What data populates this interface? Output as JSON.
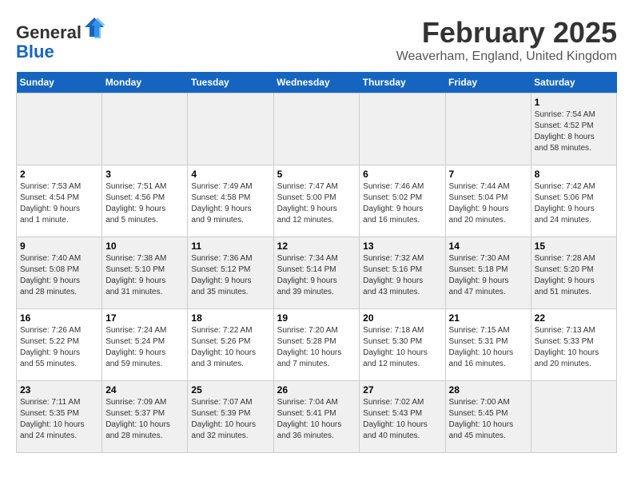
{
  "header": {
    "logo_general": "General",
    "logo_blue": "Blue",
    "month_title": "February 2025",
    "location": "Weaverham, England, United Kingdom"
  },
  "weekdays": [
    "Sunday",
    "Monday",
    "Tuesday",
    "Wednesday",
    "Thursday",
    "Friday",
    "Saturday"
  ],
  "weeks": [
    [
      {
        "day": "",
        "info": ""
      },
      {
        "day": "",
        "info": ""
      },
      {
        "day": "",
        "info": ""
      },
      {
        "day": "",
        "info": ""
      },
      {
        "day": "",
        "info": ""
      },
      {
        "day": "",
        "info": ""
      },
      {
        "day": "1",
        "info": "Sunrise: 7:54 AM\nSunset: 4:52 PM\nDaylight: 8 hours\nand 58 minutes."
      }
    ],
    [
      {
        "day": "2",
        "info": "Sunrise: 7:53 AM\nSunset: 4:54 PM\nDaylight: 9 hours\nand 1 minute."
      },
      {
        "day": "3",
        "info": "Sunrise: 7:51 AM\nSunset: 4:56 PM\nDaylight: 9 hours\nand 5 minutes."
      },
      {
        "day": "4",
        "info": "Sunrise: 7:49 AM\nSunset: 4:58 PM\nDaylight: 9 hours\nand 9 minutes."
      },
      {
        "day": "5",
        "info": "Sunrise: 7:47 AM\nSunset: 5:00 PM\nDaylight: 9 hours\nand 12 minutes."
      },
      {
        "day": "6",
        "info": "Sunrise: 7:46 AM\nSunset: 5:02 PM\nDaylight: 9 hours\nand 16 minutes."
      },
      {
        "day": "7",
        "info": "Sunrise: 7:44 AM\nSunset: 5:04 PM\nDaylight: 9 hours\nand 20 minutes."
      },
      {
        "day": "8",
        "info": "Sunrise: 7:42 AM\nSunset: 5:06 PM\nDaylight: 9 hours\nand 24 minutes."
      }
    ],
    [
      {
        "day": "9",
        "info": "Sunrise: 7:40 AM\nSunset: 5:08 PM\nDaylight: 9 hours\nand 28 minutes."
      },
      {
        "day": "10",
        "info": "Sunrise: 7:38 AM\nSunset: 5:10 PM\nDaylight: 9 hours\nand 31 minutes."
      },
      {
        "day": "11",
        "info": "Sunrise: 7:36 AM\nSunset: 5:12 PM\nDaylight: 9 hours\nand 35 minutes."
      },
      {
        "day": "12",
        "info": "Sunrise: 7:34 AM\nSunset: 5:14 PM\nDaylight: 9 hours\nand 39 minutes."
      },
      {
        "day": "13",
        "info": "Sunrise: 7:32 AM\nSunset: 5:16 PM\nDaylight: 9 hours\nand 43 minutes."
      },
      {
        "day": "14",
        "info": "Sunrise: 7:30 AM\nSunset: 5:18 PM\nDaylight: 9 hours\nand 47 minutes."
      },
      {
        "day": "15",
        "info": "Sunrise: 7:28 AM\nSunset: 5:20 PM\nDaylight: 9 hours\nand 51 minutes."
      }
    ],
    [
      {
        "day": "16",
        "info": "Sunrise: 7:26 AM\nSunset: 5:22 PM\nDaylight: 9 hours\nand 55 minutes."
      },
      {
        "day": "17",
        "info": "Sunrise: 7:24 AM\nSunset: 5:24 PM\nDaylight: 9 hours\nand 59 minutes."
      },
      {
        "day": "18",
        "info": "Sunrise: 7:22 AM\nSunset: 5:26 PM\nDaylight: 10 hours\nand 3 minutes."
      },
      {
        "day": "19",
        "info": "Sunrise: 7:20 AM\nSunset: 5:28 PM\nDaylight: 10 hours\nand 7 minutes."
      },
      {
        "day": "20",
        "info": "Sunrise: 7:18 AM\nSunset: 5:30 PM\nDaylight: 10 hours\nand 12 minutes."
      },
      {
        "day": "21",
        "info": "Sunrise: 7:15 AM\nSunset: 5:31 PM\nDaylight: 10 hours\nand 16 minutes."
      },
      {
        "day": "22",
        "info": "Sunrise: 7:13 AM\nSunset: 5:33 PM\nDaylight: 10 hours\nand 20 minutes."
      }
    ],
    [
      {
        "day": "23",
        "info": "Sunrise: 7:11 AM\nSunset: 5:35 PM\nDaylight: 10 hours\nand 24 minutes."
      },
      {
        "day": "24",
        "info": "Sunrise: 7:09 AM\nSunset: 5:37 PM\nDaylight: 10 hours\nand 28 minutes."
      },
      {
        "day": "25",
        "info": "Sunrise: 7:07 AM\nSunset: 5:39 PM\nDaylight: 10 hours\nand 32 minutes."
      },
      {
        "day": "26",
        "info": "Sunrise: 7:04 AM\nSunset: 5:41 PM\nDaylight: 10 hours\nand 36 minutes."
      },
      {
        "day": "27",
        "info": "Sunrise: 7:02 AM\nSunset: 5:43 PM\nDaylight: 10 hours\nand 40 minutes."
      },
      {
        "day": "28",
        "info": "Sunrise: 7:00 AM\nSunset: 5:45 PM\nDaylight: 10 hours\nand 45 minutes."
      },
      {
        "day": "",
        "info": ""
      }
    ]
  ]
}
